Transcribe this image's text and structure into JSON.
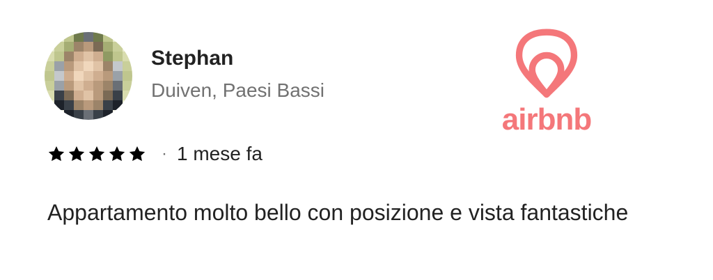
{
  "reviewer": {
    "name": "Stephan",
    "location": "Duiven, Paesi Bassi"
  },
  "rating": {
    "stars": 5,
    "max_stars": 5,
    "separator": "·",
    "relative_time": "1 mese fa"
  },
  "review": {
    "text": "Appartamento molto bello con posizione e vista fantastiche"
  },
  "brand": {
    "wordmark": "airbnb",
    "color": "#f4777a"
  },
  "colors": {
    "primary_text": "#222222",
    "secondary_text": "#717171",
    "star": "#000000"
  },
  "icons": {
    "avatar": "pixelated-avatar-icon",
    "star": "star-icon",
    "logo": "airbnb-logo-icon"
  }
}
